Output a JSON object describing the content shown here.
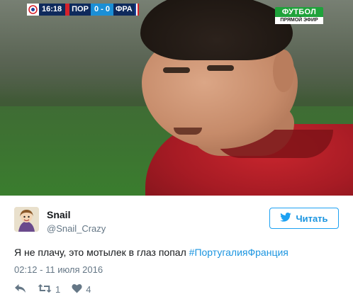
{
  "scoreboard": {
    "time": "16:18",
    "team_home": "ПОР",
    "score": "0 - 0",
    "team_away": "ФРА"
  },
  "channel": {
    "name": "ФУТБОЛ",
    "subtitle": "ПРЯМОЙ ЭФИР"
  },
  "tweet": {
    "display_name": "Snail",
    "handle": "@Snail_Crazy",
    "follow_label": "Читать",
    "text_plain": "Я не плачу, это мотылек в глаз попал ",
    "hashtag": "#ПортугалияФранция",
    "timestamp": "02:12 - 11 июля 2016",
    "retweet_count": "1",
    "like_count": "4"
  },
  "colors": {
    "accent": "#1b95e0",
    "secondary_text": "#657786",
    "primary_text": "#14171a",
    "scoreboard_navy": "#0f2a5c",
    "scoreboard_blue": "#1b8fd6",
    "channel_green": "#1fa23b"
  },
  "icons": {
    "follow": "twitter-bird-icon",
    "reply": "reply-arrow-icon",
    "retweet": "retweet-icon",
    "like": "heart-icon",
    "tournament": "euro-2016-logo"
  }
}
